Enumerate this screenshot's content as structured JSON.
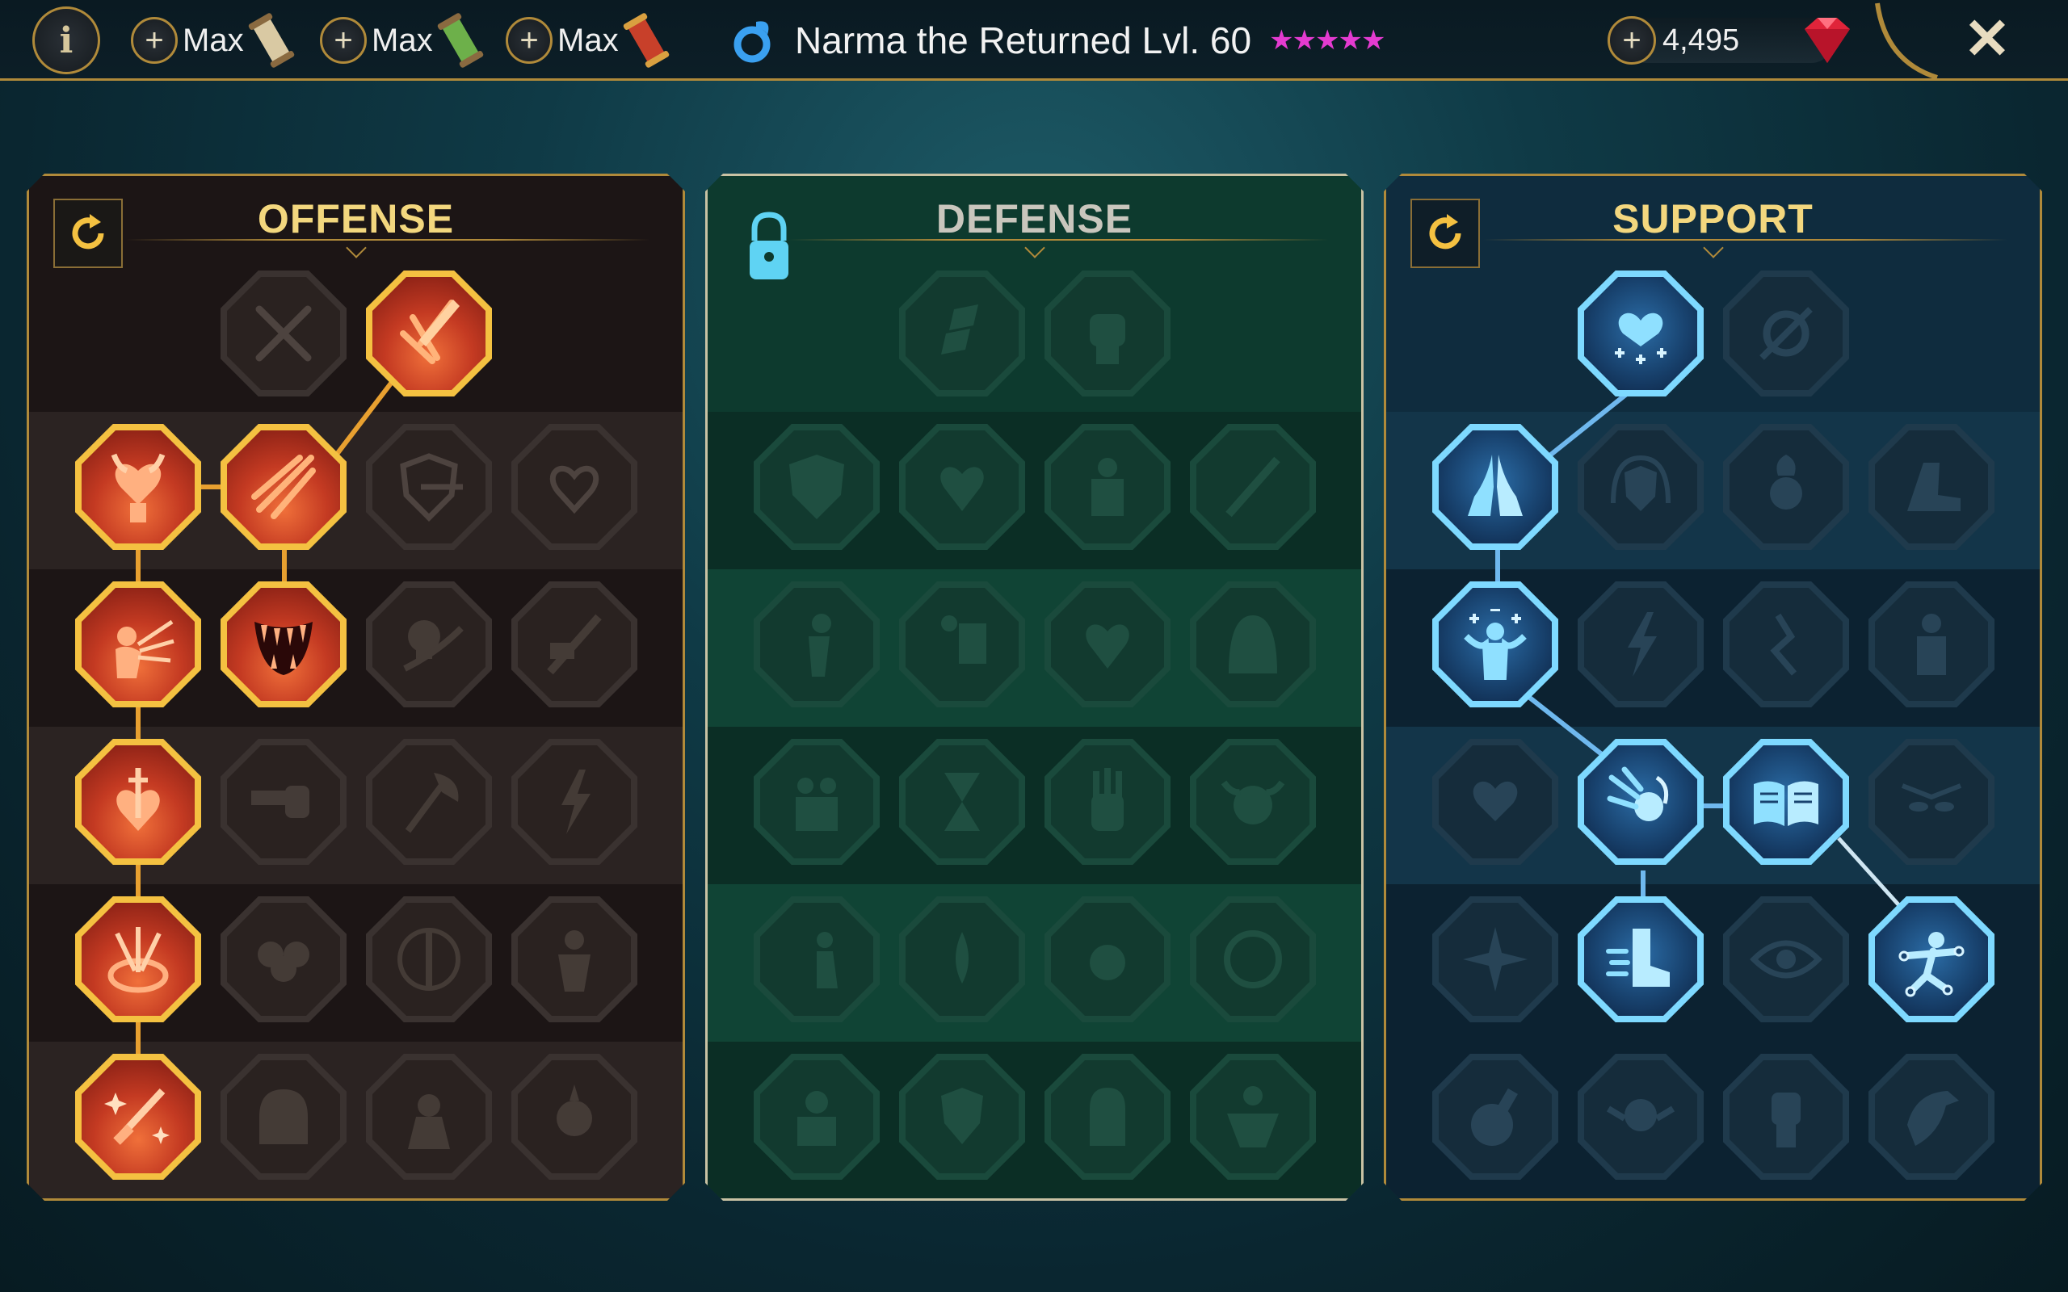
{
  "topbar": {
    "resources": [
      {
        "label": "Max",
        "item": "scroll-icon"
      },
      {
        "label": "Max",
        "item": "green-scroll-icon"
      },
      {
        "label": "Max",
        "item": "red-scroll-icon"
      }
    ],
    "hero_name": "Narma the Returned Lvl. 60",
    "stars": "★★★★★",
    "gems": "4,495",
    "info_label": "i",
    "close_label": "✕"
  },
  "panels": {
    "offense": {
      "title": "OFFENSE"
    },
    "defense": {
      "title": "DEFENSE"
    },
    "support": {
      "title": "SUPPORT"
    }
  },
  "colors": {
    "gold": "#b08a3a",
    "offense_active": "#f4c141",
    "support_active": "#7ed9ff",
    "stars": "#e43bd0"
  }
}
